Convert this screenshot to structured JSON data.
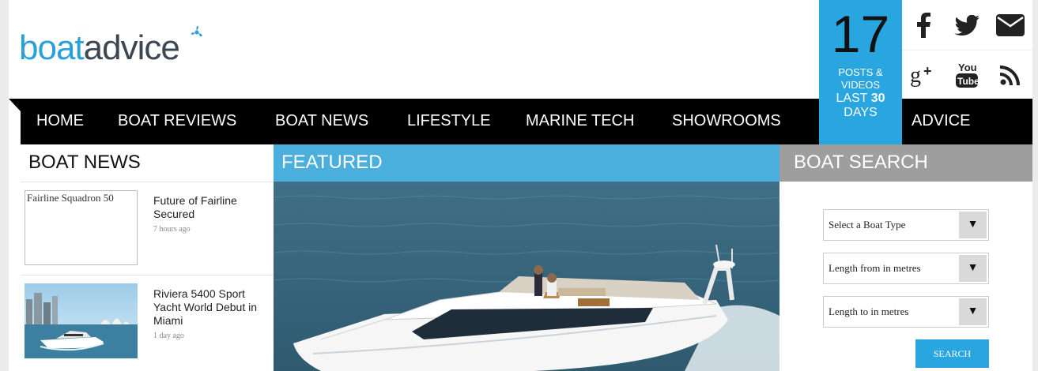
{
  "header": {
    "logo_part1": "boat",
    "logo_part2": "advice",
    "counter": {
      "number": "17",
      "line1": "POSTS &",
      "line2": "VIDEOS",
      "line3_prefix": "LAST",
      "line3_number": "30",
      "line4": "DAYS"
    },
    "social_icons": [
      "facebook-icon",
      "twitter-icon",
      "email-icon",
      "google-plus-icon",
      "youtube-icon",
      "rss-icon"
    ],
    "accent_color": "#29a6e0",
    "logo_dark_color": "#3d4754"
  },
  "nav": {
    "items": [
      "HOME",
      "BOAT REVIEWS",
      "BOAT NEWS",
      "LIFESTYLE",
      "MARINE TECH",
      "SHOWROOMS"
    ],
    "advice": "ADVICE"
  },
  "boat_news": {
    "heading": "BOAT NEWS",
    "items": [
      {
        "thumb_alt": "Fairline Squadron 50",
        "title": "Future of Fairline Secured",
        "ago": "7 hours ago"
      },
      {
        "title": "Riviera 5400 Sport Yacht World Debut in Miami",
        "ago": "1 day ago"
      }
    ]
  },
  "featured": {
    "heading": "FEATURED"
  },
  "boat_search": {
    "heading": "BOAT SEARCH",
    "boat_type": "Select a Boat Type",
    "length_from": "Length from in metres",
    "length_to": "Length to in metres",
    "arrow": "▼",
    "button": "SEARCH"
  }
}
